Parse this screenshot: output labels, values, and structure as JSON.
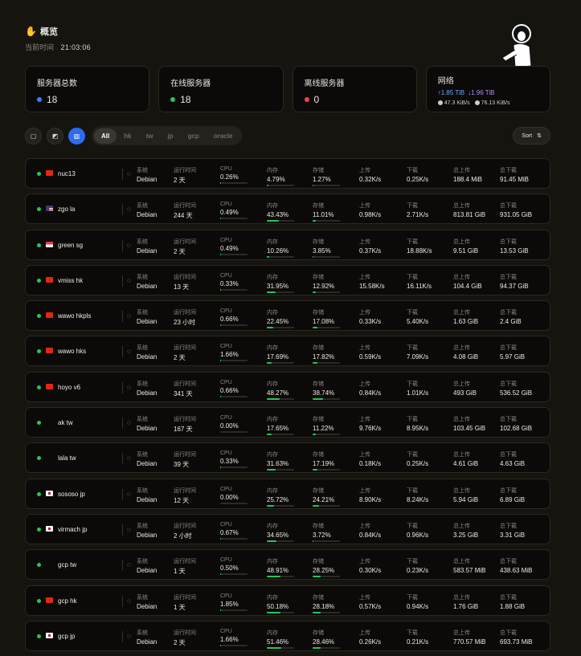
{
  "header": {
    "wave_icon": "waving-hand-icon",
    "title": "概览",
    "time_label": "当前时间",
    "time_value": "21:03:06"
  },
  "cards": {
    "total": {
      "label": "服务器总数",
      "value": "18",
      "dot_color": "#3b82f6"
    },
    "online": {
      "label": "在线服务器",
      "value": "18",
      "dot_color": "#22c55e"
    },
    "offline": {
      "label": "离线服务器",
      "value": "0",
      "dot_color": "#ef4444"
    },
    "network": {
      "label": "网络",
      "up_total": "↑1.85 TiB",
      "down_total": "↓1.96 TiB",
      "up_speed": "47.3 KiB/s",
      "down_speed": "76.13 KiB/s"
    }
  },
  "toolbar": {
    "filters": [
      "All",
      "hk",
      "tw",
      "jp",
      "gcp",
      "oracle"
    ],
    "active_filter": "All",
    "sort_label": "Sort",
    "accent": "#2d6cf0"
  },
  "labels": {
    "system": "系统",
    "uptime": "运行时间",
    "cpu": "CPU",
    "mem": "内存",
    "disk": "存储",
    "up": "上传",
    "down": "下载",
    "total_up": "总上传",
    "total_down": "总下载"
  },
  "servers": [
    {
      "name": "nuc13",
      "flag": "cn",
      "os": "Debian",
      "uptime": "2 天",
      "cpu": "0.26%",
      "cpu_pct": 0.26,
      "mem": "4.79%",
      "mem_pct": 4.79,
      "disk": "1.27%",
      "disk_pct": 1.27,
      "up": "0.32K/s",
      "down": "0.25K/s",
      "total_up": "188.4 MiB",
      "total_down": "91.45 MiB"
    },
    {
      "name": "zgo la",
      "flag": "us",
      "os": "Debian",
      "uptime": "244 天",
      "cpu": "0.49%",
      "cpu_pct": 0.49,
      "mem": "43.43%",
      "mem_pct": 43.43,
      "disk": "11.01%",
      "disk_pct": 11.01,
      "up": "0.98K/s",
      "down": "2.71K/s",
      "total_up": "813.81 GiB",
      "total_down": "931.05 GiB"
    },
    {
      "name": "green sg",
      "flag": "sg",
      "os": "Debian",
      "uptime": "2 天",
      "cpu": "0.49%",
      "cpu_pct": 0.49,
      "mem": "10.26%",
      "mem_pct": 10.26,
      "disk": "3.85%",
      "disk_pct": 3.85,
      "up": "0.37K/s",
      "down": "18.88K/s",
      "total_up": "9.51 GiB",
      "total_down": "13.53 GiB"
    },
    {
      "name": "vmiss hk",
      "flag": "hk",
      "os": "Debian",
      "uptime": "13 天",
      "cpu": "0.33%",
      "cpu_pct": 0.33,
      "mem": "31.95%",
      "mem_pct": 31.95,
      "disk": "12.92%",
      "disk_pct": 12.92,
      "up": "15.58K/s",
      "down": "16.11K/s",
      "total_up": "104.4 GiB",
      "total_down": "94.37 GiB"
    },
    {
      "name": "wawo hkpls",
      "flag": "hk",
      "os": "Debian",
      "uptime": "23 小时",
      "cpu": "0.66%",
      "cpu_pct": 0.66,
      "mem": "22.45%",
      "mem_pct": 22.45,
      "disk": "17.08%",
      "disk_pct": 17.08,
      "up": "0.33K/s",
      "down": "5.40K/s",
      "total_up": "1.63 GiB",
      "total_down": "2.4 GiB"
    },
    {
      "name": "wawo hks",
      "flag": "hk",
      "os": "Debian",
      "uptime": "2 天",
      "cpu": "1.66%",
      "cpu_pct": 1.66,
      "mem": "17.69%",
      "mem_pct": 17.69,
      "disk": "17.82%",
      "disk_pct": 17.82,
      "up": "0.59K/s",
      "down": "7.09K/s",
      "total_up": "4.08 GiB",
      "total_down": "5.97 GiB"
    },
    {
      "name": "hoyo v6",
      "flag": "hk",
      "os": "Debian",
      "uptime": "341 天",
      "cpu": "0.66%",
      "cpu_pct": 0.66,
      "mem": "48.27%",
      "mem_pct": 48.27,
      "disk": "38.74%",
      "disk_pct": 38.74,
      "up": "0.84K/s",
      "down": "1.01K/s",
      "total_up": "493 GiB",
      "total_down": "536.52 GiB"
    },
    {
      "name": "ak tw",
      "flag": "tw",
      "os": "Debian",
      "uptime": "167 天",
      "cpu": "0.00%",
      "cpu_pct": 0.0,
      "mem": "17.65%",
      "mem_pct": 17.65,
      "disk": "11.22%",
      "disk_pct": 11.22,
      "up": "9.76K/s",
      "down": "8.95K/s",
      "total_up": "103.45 GiB",
      "total_down": "102.68 GiB"
    },
    {
      "name": "lala tw",
      "flag": "tw",
      "os": "Debian",
      "uptime": "39 天",
      "cpu": "0.33%",
      "cpu_pct": 0.33,
      "mem": "31.63%",
      "mem_pct": 31.63,
      "disk": "17.19%",
      "disk_pct": 17.19,
      "up": "0.18K/s",
      "down": "0.25K/s",
      "total_up": "4.61 GiB",
      "total_down": "4.63 GiB"
    },
    {
      "name": "sososo jp",
      "flag": "jp",
      "os": "Debian",
      "uptime": "12 天",
      "cpu": "0.00%",
      "cpu_pct": 0.0,
      "mem": "25.72%",
      "mem_pct": 25.72,
      "disk": "24.21%",
      "disk_pct": 24.21,
      "up": "8.90K/s",
      "down": "8.24K/s",
      "total_up": "5.94 GiB",
      "total_down": "6.89 GiB"
    },
    {
      "name": "virmach jp",
      "flag": "jp",
      "os": "Debian",
      "uptime": "2 小时",
      "cpu": "0.67%",
      "cpu_pct": 0.67,
      "mem": "34.65%",
      "mem_pct": 34.65,
      "disk": "3.72%",
      "disk_pct": 3.72,
      "up": "0.84K/s",
      "down": "0.96K/s",
      "total_up": "3.25 GiB",
      "total_down": "3.31 GiB"
    },
    {
      "name": "gcp tw",
      "flag": "tw",
      "os": "Debian",
      "uptime": "1 天",
      "cpu": "0.50%",
      "cpu_pct": 0.5,
      "mem": "48.91%",
      "mem_pct": 48.91,
      "disk": "28.25%",
      "disk_pct": 28.25,
      "up": "0.30K/s",
      "down": "0.23K/s",
      "total_up": "583.57 MiB",
      "total_down": "438.63 MiB"
    },
    {
      "name": "gcp hk",
      "flag": "hk",
      "os": "Debian",
      "uptime": "1 天",
      "cpu": "1.85%",
      "cpu_pct": 1.85,
      "mem": "50.18%",
      "mem_pct": 50.18,
      "disk": "28.18%",
      "disk_pct": 28.18,
      "up": "0.57K/s",
      "down": "0.94K/s",
      "total_up": "1.76 GiB",
      "total_down": "1.88 GiB"
    },
    {
      "name": "gcp jp",
      "flag": "jp",
      "os": "Debian",
      "uptime": "2 天",
      "cpu": "1.66%",
      "cpu_pct": 1.66,
      "mem": "51.46%",
      "mem_pct": 51.46,
      "disk": "28.46%",
      "disk_pct": 28.46,
      "up": "0.26K/s",
      "down": "0.21K/s",
      "total_up": "770.57 MiB",
      "total_down": "693.73 MiB"
    }
  ]
}
